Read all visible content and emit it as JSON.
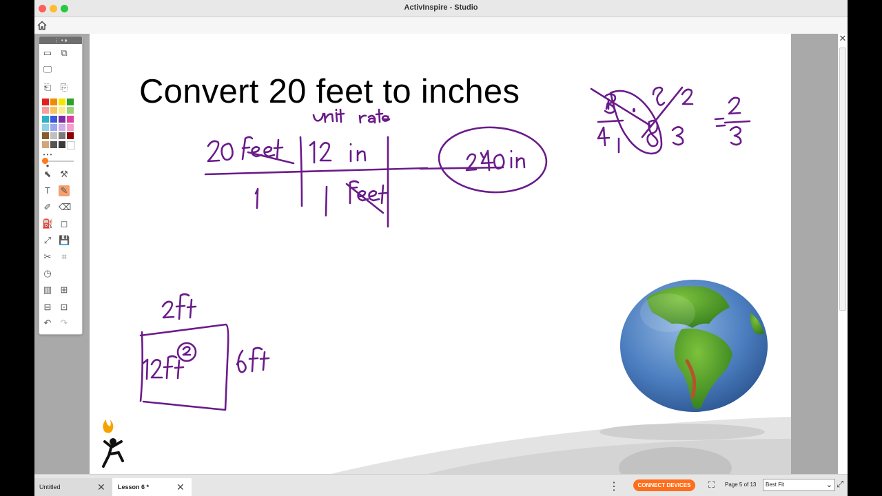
{
  "window": {
    "title": "ActivInspire - Studio"
  },
  "slide": {
    "heading": "Convert 20 feet to inches",
    "ink_notes": [
      "unit rate",
      "20 feet",
      "12 in",
      "1",
      "1 feet",
      "240in",
      "2ft",
      "12 ft",
      "2",
      "6ft",
      "= 2/3"
    ]
  },
  "tabs": [
    {
      "label": "Untitled"
    },
    {
      "label": "Lesson 6 *"
    }
  ],
  "statusbar": {
    "connect_label": "CONNECT DEVICES",
    "page_counter": "Page 5 of 13",
    "zoom_value": "Best Fit"
  },
  "toolbox": {
    "palette": [
      "#e02020",
      "#f08a00",
      "#f5e600",
      "#2ba12b",
      "#f4a0a0",
      "#f9c35d",
      "#f9ee8f",
      "#9ed27a",
      "#2fb0c8",
      "#3a5bd9",
      "#7a2fa6",
      "#e040a0",
      "#8fd0e6",
      "#9aa8ef",
      "#cdb0e6",
      "#f3a0d0",
      "#8b5a2b",
      "#c0c0c0",
      "#7a7a7a",
      "#8b0000",
      "#d2a679",
      "#555555",
      "#3a3a3a",
      "#ffffff"
    ],
    "icons": [
      "whiteboard-icon",
      "desktop-icon",
      "screen-icon",
      "page-back-icon",
      "page-forward-icon",
      "select-icon",
      "tools-icon",
      "text-icon",
      "pen-icon",
      "highlighter-icon",
      "eraser-icon",
      "fill-icon",
      "shapes-icon",
      "connector-icon",
      "save-icon",
      "clear-icon",
      "camera-icon",
      "clock-icon",
      "pages-icon",
      "library-icon",
      "revealer-icon",
      "spotlight-icon",
      "undo-icon",
      "redo-icon"
    ]
  }
}
